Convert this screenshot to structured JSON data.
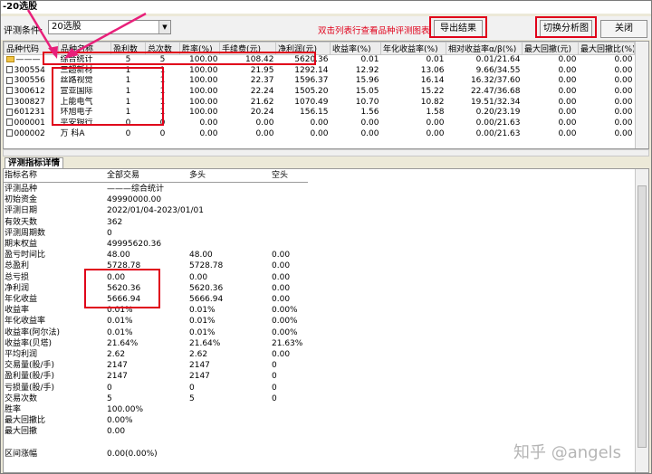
{
  "window": {
    "title": "-20选股"
  },
  "toolbar": {
    "condition_label": "评测条件:",
    "condition_value": "20选股",
    "hint": "双击列表行查看品种评测图表",
    "export_label": "导出结果",
    "switch_label": "切换分析图",
    "close_label": "关闭"
  },
  "grid": {
    "columns": [
      "品种代码",
      "品种名称",
      "盈利数",
      "总次数",
      "胜率(%)",
      "手续费(元)",
      "净利润(元)",
      "收益率(%)",
      "年化收益率(%)",
      "相对收益率α/β(%)",
      "最大回撤(元)",
      "最大回撤比(%)"
    ],
    "rows": [
      {
        "code": "———",
        "name": "综合统计",
        "win": "5",
        "total": "5",
        "rate": "100.00",
        "fee": "108.42",
        "profit": "5620.36",
        "ret": "0.01",
        "ann": "0.01",
        "rel": "0.01/21.64",
        "dd": "0.00",
        "ddr": "0.00"
      },
      {
        "code": "300554",
        "name": "三超新材",
        "win": "1",
        "total": "1",
        "rate": "100.00",
        "fee": "21.95",
        "profit": "1292.14",
        "ret": "12.92",
        "ann": "13.06",
        "rel": "9.66/34.55",
        "dd": "0.00",
        "ddr": "0.00"
      },
      {
        "code": "300556",
        "name": "丝路视觉",
        "win": "1",
        "total": "1",
        "rate": "100.00",
        "fee": "22.37",
        "profit": "1596.37",
        "ret": "15.96",
        "ann": "16.14",
        "rel": "16.32/37.60",
        "dd": "0.00",
        "ddr": "0.00"
      },
      {
        "code": "300612",
        "name": "宣亚国际",
        "win": "1",
        "total": "1",
        "rate": "100.00",
        "fee": "22.24",
        "profit": "1505.20",
        "ret": "15.05",
        "ann": "15.22",
        "rel": "22.47/36.68",
        "dd": "0.00",
        "ddr": "0.00"
      },
      {
        "code": "300827",
        "name": "上能电气",
        "win": "1",
        "total": "1",
        "rate": "100.00",
        "fee": "21.62",
        "profit": "1070.49",
        "ret": "10.70",
        "ann": "10.82",
        "rel": "19.51/32.34",
        "dd": "0.00",
        "ddr": "0.00"
      },
      {
        "code": "601231",
        "name": "环旭电子",
        "win": "1",
        "total": "1",
        "rate": "100.00",
        "fee": "20.24",
        "profit": "156.15",
        "ret": "1.56",
        "ann": "1.58",
        "rel": "0.20/23.19",
        "dd": "0.00",
        "ddr": "0.00"
      },
      {
        "code": "000001",
        "name": "平安银行",
        "win": "0",
        "total": "0",
        "rate": "0.00",
        "fee": "0.00",
        "profit": "0.00",
        "ret": "0.00",
        "ann": "0.00",
        "rel": "0.00/21.63",
        "dd": "0.00",
        "ddr": "0.00"
      },
      {
        "code": "000002",
        "name": "万 科A",
        "win": "0",
        "total": "0",
        "rate": "0.00",
        "fee": "0.00",
        "profit": "0.00",
        "ret": "0.00",
        "ann": "0.00",
        "rel": "0.00/21.63",
        "dd": "0.00",
        "ddr": "0.00"
      }
    ]
  },
  "detail": {
    "tab_label": "评测指标详情",
    "headers": [
      "指标名称",
      "全部交易",
      "多头",
      "空头"
    ],
    "rows": [
      [
        "评测品种",
        "———综合统计",
        "",
        ""
      ],
      [
        "初始资金",
        "49990000.00",
        "",
        ""
      ],
      [
        "评测日期",
        "2022/01/04-2023/01/01",
        "",
        ""
      ],
      [
        "有效天数",
        "362",
        "",
        ""
      ],
      [
        "评测周期数",
        "0",
        "",
        ""
      ],
      [
        "期末权益",
        "49995620.36",
        "",
        ""
      ],
      [
        "盈亏时间比",
        "48.00",
        "48.00",
        "0.00"
      ],
      [
        "总盈利",
        "5728.78",
        "5728.78",
        "0.00"
      ],
      [
        "总亏损",
        "0.00",
        "0.00",
        "0.00"
      ],
      [
        "净利润",
        "5620.36",
        "5620.36",
        "0.00"
      ],
      [
        "年化收益",
        "5666.94",
        "5666.94",
        "0.00"
      ],
      [
        "收益率",
        "0.01%",
        "0.01%",
        "0.00%"
      ],
      [
        "年化收益率",
        "0.01%",
        "0.01%",
        "0.00%"
      ],
      [
        "收益率(阿尔法)",
        "0.01%",
        "0.01%",
        "0.00%"
      ],
      [
        "收益率(贝塔)",
        "21.64%",
        "21.64%",
        "21.63%"
      ],
      [
        "平均利润",
        "2.62",
        "2.62",
        "0.00"
      ],
      [
        "交易量(股/手)",
        "2147",
        "2147",
        "0"
      ],
      [
        "盈利量(股/手)",
        "2147",
        "2147",
        "0"
      ],
      [
        "亏损量(股/手)",
        "0",
        "0",
        "0"
      ],
      [
        "交易次数",
        "5",
        "5",
        "0"
      ],
      [
        "胜率",
        "100.00%",
        "",
        ""
      ],
      [
        "最大回撤比",
        "0.00%",
        "",
        ""
      ],
      [
        "最大回撤",
        "0.00",
        "",
        ""
      ],
      [
        "",
        "",
        "",
        ""
      ],
      [
        "区间涨幅",
        "0.00(0.00%)",
        "",
        ""
      ]
    ]
  },
  "watermark": "知乎 @angels",
  "colors": {
    "highlight": "#e0001a",
    "arrow": "#e8207a"
  }
}
